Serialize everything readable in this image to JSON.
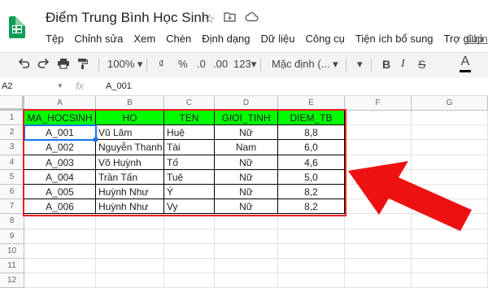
{
  "doc": {
    "title": "Điểm Trung Bình Học Sinh"
  },
  "menu": [
    "Tệp",
    "Chỉnh sửa",
    "Xem",
    "Chèn",
    "Định dạng",
    "Dữ liệu",
    "Công cụ",
    "Tiện ích bổ sung",
    "Trợ giúp"
  ],
  "menu_link": "Chỉn",
  "toolbar": {
    "zoom": "100%",
    "currency": "₫",
    "percent": "%",
    "dec_less": ".0",
    "dec_more": ".00",
    "more_formats": "123",
    "font": "Mặc định (...",
    "text_color_letter": "A"
  },
  "formula_bar": {
    "cell_ref": "A2",
    "fx": "fx",
    "value": "A_001"
  },
  "sheet": {
    "columns": [
      "A",
      "B",
      "C",
      "D",
      "E",
      "F",
      "G"
    ],
    "row_numbers": [
      "1",
      "2",
      "3",
      "4",
      "5",
      "6",
      "7",
      "8",
      "9",
      "10",
      "11",
      "12"
    ],
    "header": [
      "MA_HOCSINH",
      "HO",
      "TEN",
      "GIOI_TINH",
      "DIEM_TB"
    ],
    "rows": [
      [
        "A_001",
        "Vũ Lâm",
        "Huệ",
        "Nữ",
        "8,8"
      ],
      [
        "A_002",
        "Nguyễn Thanh",
        "Tài",
        "Nam",
        "6,0"
      ],
      [
        "A_003",
        "Võ Huỳnh",
        "Tố",
        "Nữ",
        "4,6"
      ],
      [
        "A_004",
        "Trần Tấn",
        "Tuệ",
        "Nữ",
        "5,0"
      ],
      [
        "A_005",
        "Huỳnh Như",
        "Ý",
        "Nữ",
        "8,2"
      ],
      [
        "A_006",
        "Huỳnh Như",
        "Vy",
        "Nữ",
        "8,2"
      ]
    ]
  },
  "colors": {
    "header_fill": "#00ff00",
    "highlight_box": "#ea1e1e",
    "arrow": "#ee1111",
    "selection": "#1a73e8"
  },
  "icons": [
    "sheets-logo",
    "star-icon",
    "move-to-folder-icon",
    "cloud-saved-icon",
    "undo-icon",
    "redo-icon",
    "print-icon",
    "paint-format-icon",
    "dropdown-icon",
    "text-color-icon"
  ]
}
